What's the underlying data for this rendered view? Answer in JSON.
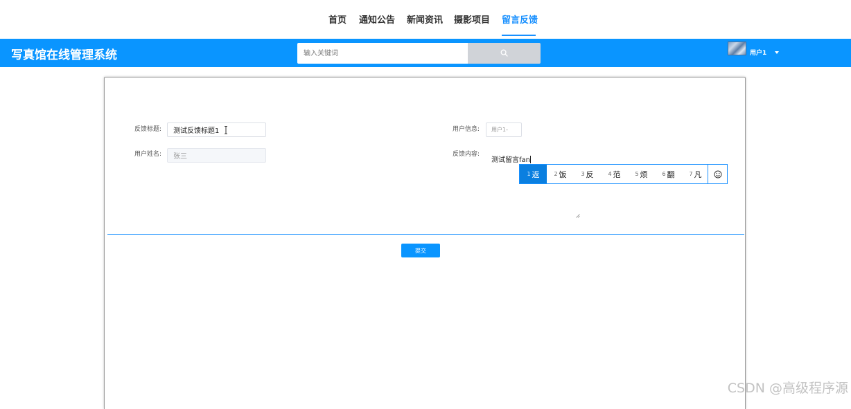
{
  "nav": {
    "items": [
      {
        "label": "首页"
      },
      {
        "label": "通知公告"
      },
      {
        "label": "新闻资讯"
      },
      {
        "label": "摄影项目"
      },
      {
        "label": "留言反馈",
        "active": true
      }
    ]
  },
  "header": {
    "title": "写真馆在线管理系统",
    "search": {
      "placeholder": "输入关键词",
      "value": ""
    },
    "user": {
      "name": "用户1"
    }
  },
  "form": {
    "title_label": "反馈标题:",
    "title_value": "测试反馈标题1",
    "userinfo_label": "用户信息:",
    "userinfo_value": "用户1-",
    "username_label": "用户姓名:",
    "username_value": "张三",
    "content_label": "反馈内容:",
    "content_value": "测试留言fan",
    "submit_label": "提交"
  },
  "ime": {
    "candidates": [
      {
        "num": "1",
        "text": "返"
      },
      {
        "num": "2",
        "text": "饭"
      },
      {
        "num": "3",
        "text": "反"
      },
      {
        "num": "4",
        "text": "范"
      },
      {
        "num": "5",
        "text": "烦"
      },
      {
        "num": "6",
        "text": "翻"
      },
      {
        "num": "7",
        "text": "凡"
      }
    ],
    "selected_index": 0
  },
  "watermark": "CSDN @高级程序源",
  "colors": {
    "primary": "#0a95ff",
    "active_nav": "#1890ff",
    "search_button": "#d0d3d8"
  }
}
